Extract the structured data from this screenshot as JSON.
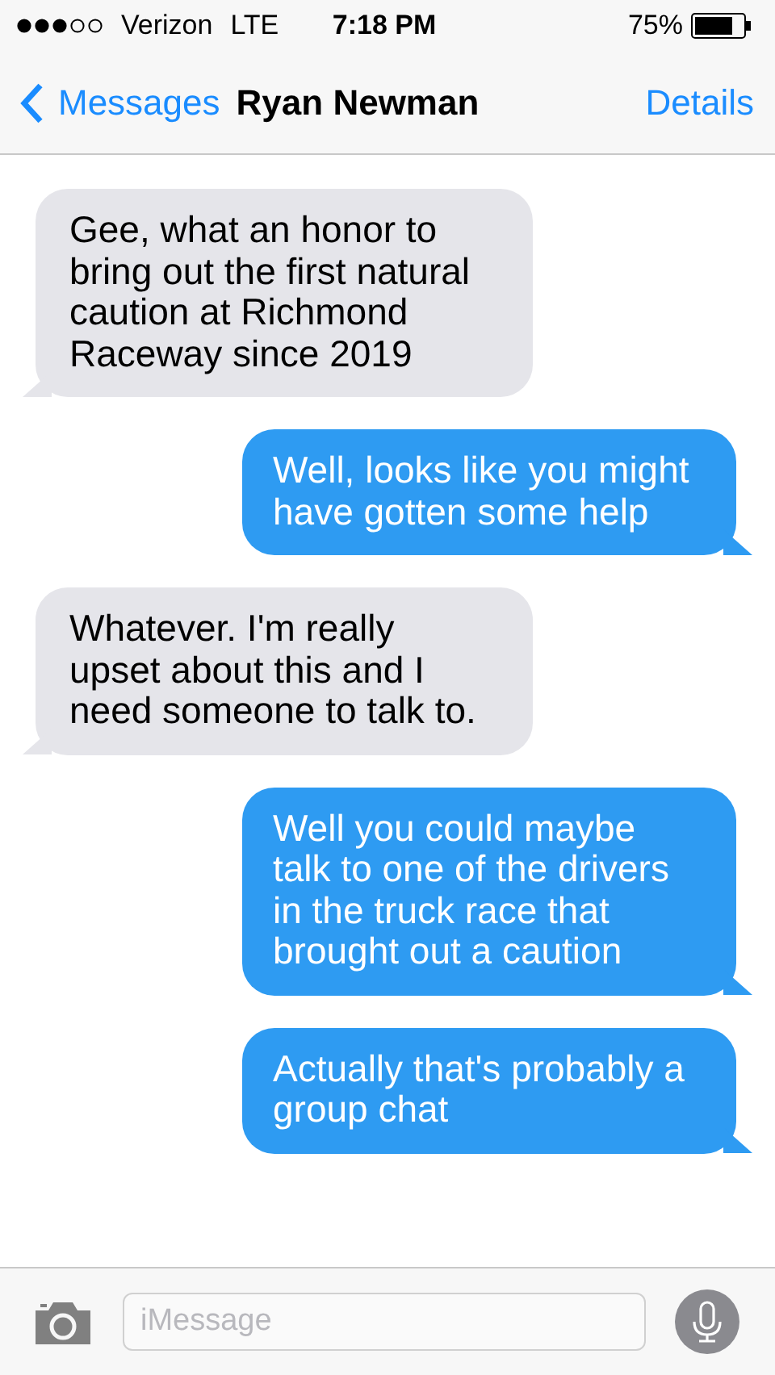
{
  "status_bar": {
    "carrier": "Verizon",
    "network": "LTE",
    "time": "7:18 PM",
    "battery": "75%"
  },
  "nav": {
    "back": "Messages",
    "title": "Ryan Newman",
    "action": "Details"
  },
  "messages": [
    {
      "kind": "incoming",
      "text": "Gee, what an honor to bring out the first natural caution at Richmond Raceway since 2019"
    },
    {
      "kind": "outgoing",
      "text": "Well, looks like you might have gotten some help"
    },
    {
      "kind": "incoming",
      "text": "Whatever. I'm really upset about this and I need someone to talk to."
    },
    {
      "kind": "outgoing",
      "text": "Well you could maybe talk to one of the drivers in the truck race that brought out a caution"
    },
    {
      "kind": "outgoing",
      "text": "Actually that's probably a group chat"
    }
  ],
  "composer": {
    "placeholder": "iMessage"
  }
}
